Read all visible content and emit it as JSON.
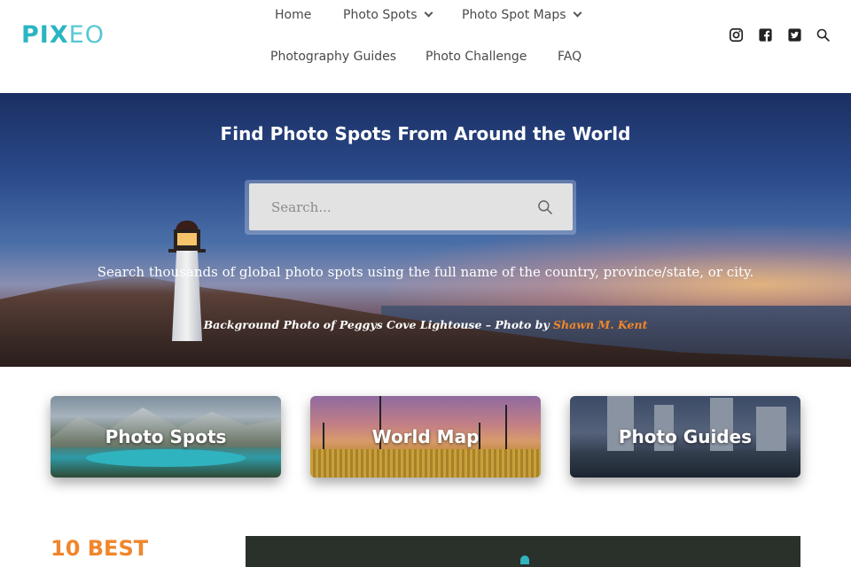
{
  "header": {
    "logo": {
      "part1": "PIX",
      "part2": "EO"
    },
    "nav": {
      "home": "Home",
      "photo_spots": "Photo Spots",
      "photo_spot_maps": "Photo Spot Maps",
      "photography_guides": "Photography Guides",
      "photo_challenge": "Photo Challenge",
      "faq": "FAQ"
    },
    "social_icons": [
      "instagram-icon",
      "facebook-icon",
      "twitter-icon",
      "search-icon"
    ]
  },
  "hero": {
    "title": "Find Photo Spots From Around the World",
    "search_placeholder": "Search...",
    "subtitle": "Search thousands of global photo spots using the full name of the country, province/state, or city.",
    "credit_prefix": "Background Photo of Peggys Cove Lightouse – Photo by ",
    "credit_author": "Shawn M. Kent"
  },
  "cards": [
    {
      "label": "Photo Spots"
    },
    {
      "label": "World Map"
    },
    {
      "label": "Photo Guides"
    }
  ],
  "section": {
    "title": "10 BEST"
  },
  "colors": {
    "brand": "#2bb5c2",
    "accent": "#f0862c"
  }
}
